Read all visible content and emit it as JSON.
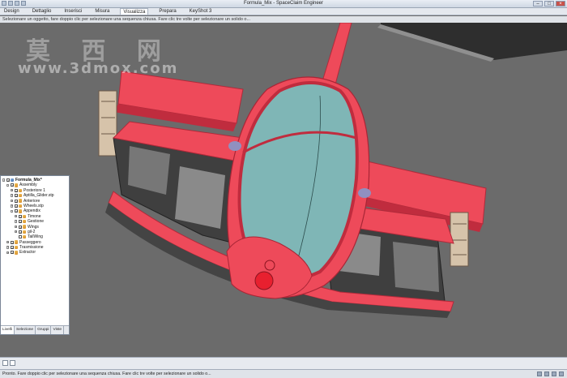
{
  "window": {
    "title": "Formula_Mix - SpaceClaim Engineer"
  },
  "ribbon": {
    "tabs": [
      "Design",
      "Dettaglio",
      "Inserisci",
      "Misura",
      "Visualizza",
      "Prepara",
      "KeyShot 3"
    ]
  },
  "hint": "Selezionare un oggetto, fare doppio clic per selezionare una sequenza chiusa. Fare clic tre volte per selezionare un solido o...",
  "watermark": {
    "chars": "莫 西 网",
    "url": "www.3dmox.com"
  },
  "structure": {
    "items": [
      {
        "label": "Formula_Mix*",
        "level": 0,
        "expander": "-",
        "checked": true,
        "root": true
      },
      {
        "label": "Assembly",
        "level": 1,
        "expander": "-",
        "checked": true
      },
      {
        "label": "Posteriore 1",
        "level": 2,
        "expander": "+",
        "checked": true
      },
      {
        "label": "Aptilla_Glider.stp",
        "level": 2,
        "expander": "+",
        "checked": true
      },
      {
        "label": "Anteriore",
        "level": 2,
        "expander": "+",
        "checked": true
      },
      {
        "label": "Wheels.stp",
        "level": 2,
        "expander": "+",
        "checked": true
      },
      {
        "label": "Appendix",
        "level": 2,
        "expander": "-",
        "checked": true
      },
      {
        "label": "Timone",
        "level": 3,
        "expander": "+",
        "checked": true
      },
      {
        "label": "Gestione",
        "level": 3,
        "expander": "+",
        "checked": true
      },
      {
        "label": "Wings",
        "level": 3,
        "expander": "+",
        "checked": true
      },
      {
        "label": "gil-2",
        "level": 3,
        "expander": "+",
        "checked": true
      },
      {
        "label": "TailWing",
        "level": 3,
        "expander": "",
        "checked": false
      },
      {
        "label": "Passeggero",
        "level": 1,
        "expander": "+",
        "checked": true
      },
      {
        "label": "Trasmissione",
        "level": 1,
        "expander": "+",
        "checked": true
      },
      {
        "label": "Extractor",
        "level": 1,
        "expander": "+",
        "checked": true
      }
    ],
    "tabs": [
      "Livelli",
      "Selezione",
      "Gruppi",
      "Viste"
    ]
  },
  "status": {
    "message": "Pronto. Fare doppio clic per selezionare una sequenza chiusa. Fare clic tre volte per selezionare un solido o..."
  },
  "colors": {
    "body": "#ee4a5a",
    "body_dark": "#c02c3e",
    "canopy": "#7fb6b6",
    "background": "#6b6b6b",
    "grille": "#3a3a3a"
  }
}
